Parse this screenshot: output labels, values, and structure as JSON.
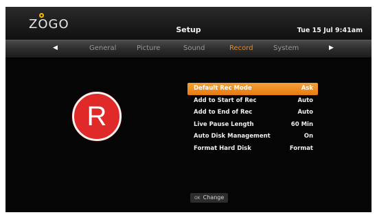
{
  "header": {
    "logo_prefix": "Z",
    "logo_o": "O",
    "logo_suffix": "GO",
    "title": "Setup",
    "datetime": "Tue 15 Jul 9:41am"
  },
  "tabs": {
    "prev_icon": "◀",
    "next_icon": "▶",
    "items": [
      {
        "label": "General",
        "active": false
      },
      {
        "label": "Picture",
        "active": false
      },
      {
        "label": "Sound",
        "active": false
      },
      {
        "label": "Record",
        "active": true
      },
      {
        "label": "System",
        "active": false
      }
    ]
  },
  "icon": {
    "letter": "R",
    "color": "#e02a2a"
  },
  "menu": {
    "items": [
      {
        "label": "Default Rec Mode",
        "value": "Ask",
        "selected": true
      },
      {
        "label": "Add to Start of Rec",
        "value": "Auto",
        "selected": false
      },
      {
        "label": "Add to End of Rec",
        "value": "Auto",
        "selected": false
      },
      {
        "label": "Live Pause Length",
        "value": "60 Min",
        "selected": false
      },
      {
        "label": "Auto Disk Management",
        "value": "On",
        "selected": false
      },
      {
        "label": "Format Hard Disk",
        "value": "Format",
        "selected": false
      }
    ]
  },
  "hint": {
    "key": "OK",
    "label": "Change"
  },
  "colors": {
    "accent": "#f08a1c",
    "background": "#050505"
  }
}
